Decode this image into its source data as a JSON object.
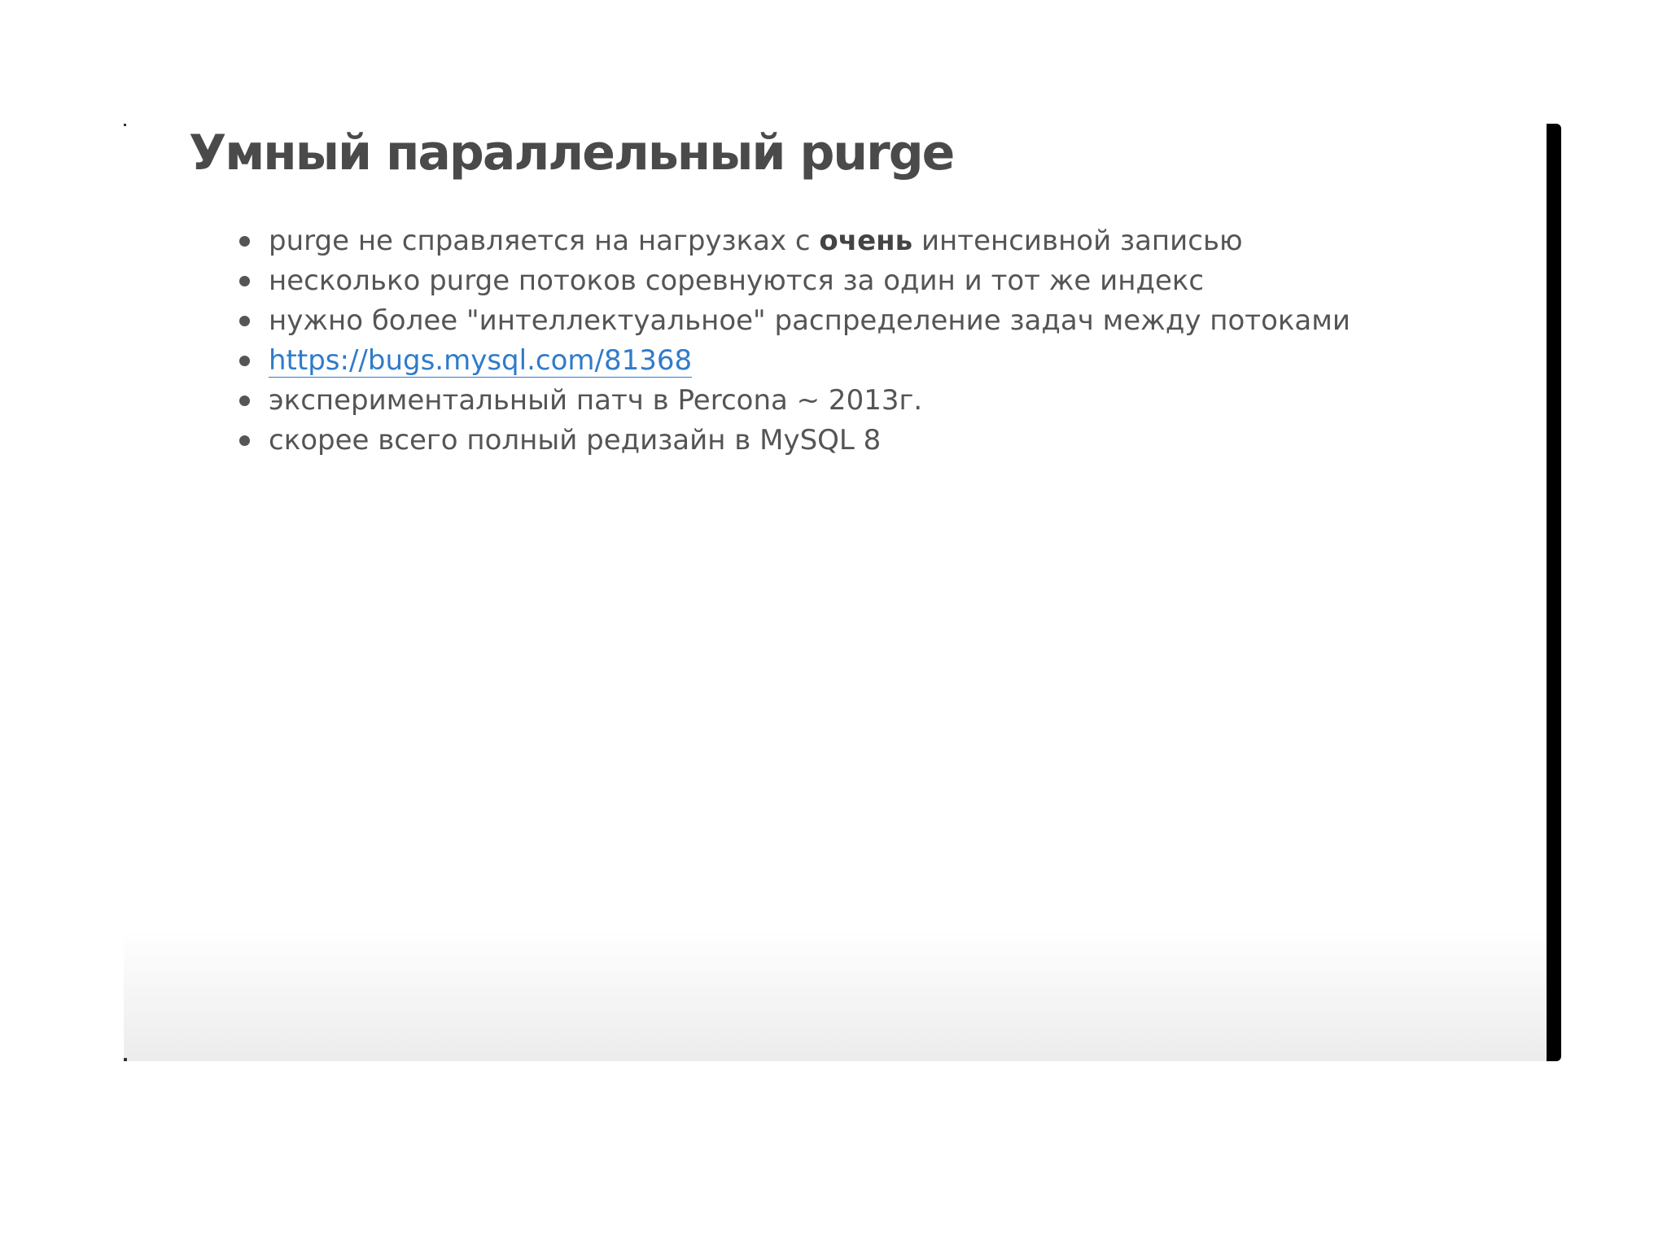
{
  "slide": {
    "title": "Умный параллельный purge",
    "bullets": [
      {
        "before": "purge не справляется на нагрузках с ",
        "bold": "очень",
        "after": " интенсивной записью"
      },
      {
        "text": "несколько purge потоков соревнуются за один и тот же индекс"
      },
      {
        "text": "нужно более \"интеллектуальное\" распределение задач между потоками"
      },
      {
        "link": "https://bugs.mysql.com/81368"
      },
      {
        "text": "экспериментальный патч в Percona ~ 2013г."
      },
      {
        "text": "скорее всего полный редизайн в MySQL 8"
      }
    ]
  },
  "colors": {
    "title": "#4a4a4a",
    "text": "#555555",
    "link": "#2f7bcb",
    "frame": "#000000"
  }
}
